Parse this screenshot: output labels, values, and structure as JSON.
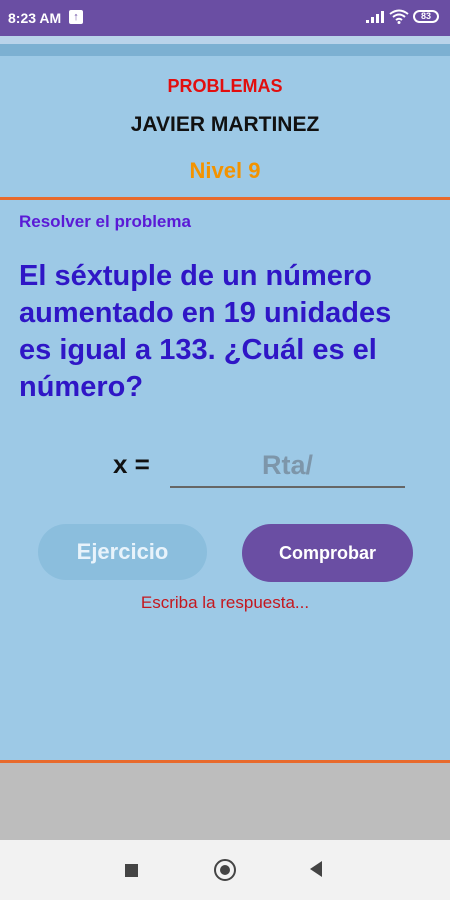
{
  "status_bar": {
    "time": "8:23 AM",
    "battery": "83"
  },
  "header": {
    "title": "PROBLEMAS",
    "user": "JAVIER MARTINEZ",
    "level": "Nivel 9"
  },
  "problem": {
    "instruction": "Resolver el problema",
    "text": "El séxtuple de un número aumentado en 19 unidades es igual a 133. ¿Cuál es el número?"
  },
  "answer": {
    "label": "x =",
    "placeholder": "Rta/",
    "value": ""
  },
  "buttons": {
    "exercise_label": "Ejercicio",
    "check_label": "Comprobar"
  },
  "feedback": "Escriba la respuesta...",
  "colors": {
    "accent": "#6a4ea3",
    "background": "#9dc9e6",
    "divider": "#e86a2c"
  }
}
